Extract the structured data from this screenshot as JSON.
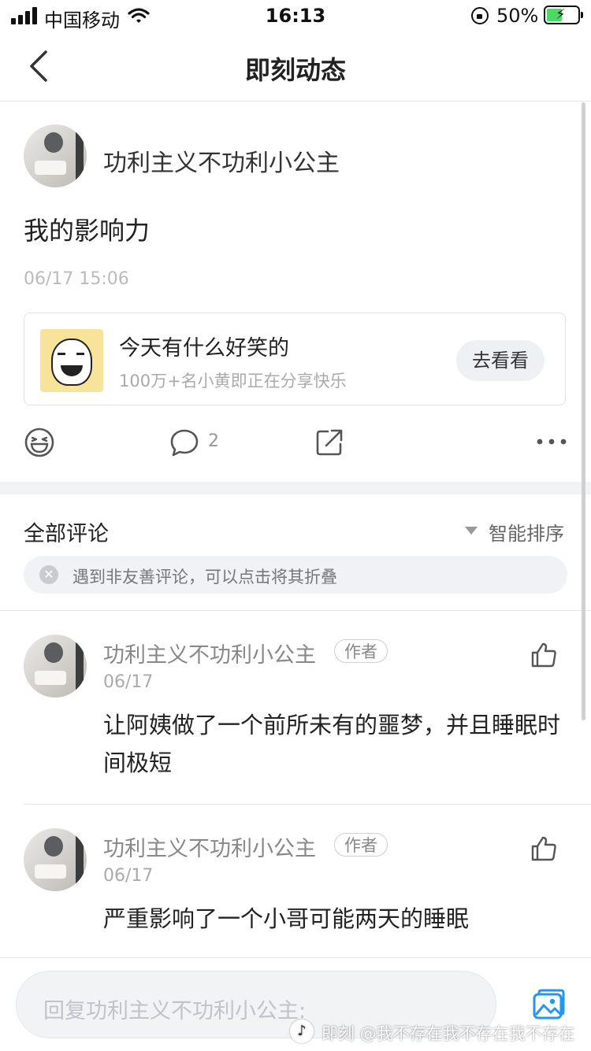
{
  "status_bar": {
    "carrier": "中国移动",
    "time": "16:13",
    "battery_percent": "50%",
    "battery_level": 0.5
  },
  "nav": {
    "title": "即刻动态"
  },
  "post": {
    "author": "功利主义不功利小公主",
    "text": "我的影响力",
    "time": "06/17 15:06",
    "card": {
      "title": "今天有什么好笑的",
      "subtitle": "100万+名小黄即正在分享快乐",
      "button": "去看看"
    },
    "comment_count": "2"
  },
  "comments_section": {
    "title": "全部评论",
    "sort_label": "智能排序",
    "tip": "遇到非友善评论，可以点击将其折叠"
  },
  "comments": [
    {
      "author": "功利主义不功利小公主",
      "badge": "作者",
      "time": "06/17",
      "text": "让阿姨做了一个前所未有的噩梦，并且睡眠时间极短"
    },
    {
      "author": "功利主义不功利小公主",
      "badge": "作者",
      "time": "06/17",
      "text": "严重影响了一个小哥可能两天的睡眠"
    }
  ],
  "reply_bar": {
    "placeholder": "回复功利主义不功利小公主:"
  },
  "watermark": "即刻 @我不存在我不存在我不存在"
}
